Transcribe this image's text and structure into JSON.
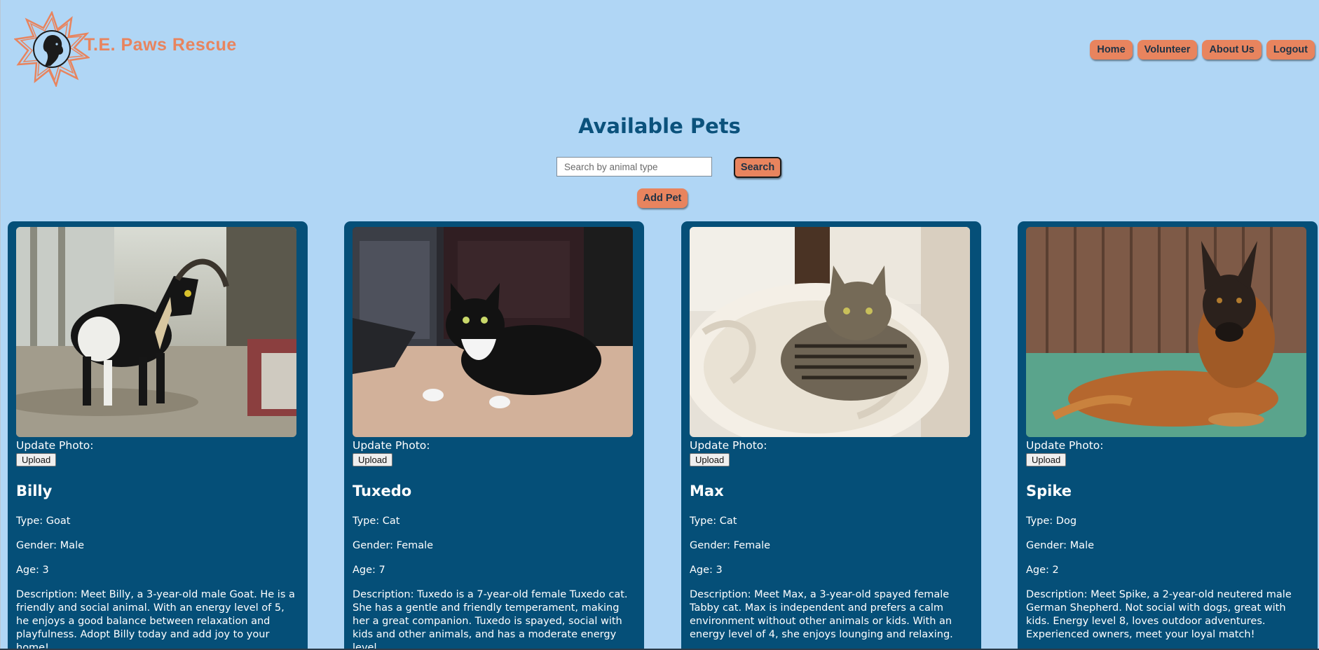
{
  "header": {
    "brand": "T.E. Paws Rescue",
    "nav": [
      "Home",
      "Volunteer",
      "About Us",
      "Logout"
    ]
  },
  "main": {
    "title": "Available Pets",
    "search": {
      "placeholder": "Search by animal type",
      "value": "",
      "button": "Search"
    },
    "add_pet": "Add Pet"
  },
  "pets": [
    {
      "update_label": "Update Photo:",
      "upload": "Upload",
      "name": "Billy",
      "type": "Type: Goat",
      "gender": "Gender: Male",
      "age": "Age: 3",
      "description": "Description: Meet Billy, a 3-year-old male Goat. He is a friendly and social animal. With an energy level of 5, he enjoys a good balance between relaxation and playfulness. Adopt Billy today and add joy to your home!"
    },
    {
      "update_label": "Update Photo:",
      "upload": "Upload",
      "name": "Tuxedo",
      "type": "Type: Cat",
      "gender": "Gender: Female",
      "age": "Age: 7",
      "description": "Description: Tuxedo is a 7-year-old female Tuxedo cat. She has a gentle and friendly temperament, making her a great companion. Tuxedo is spayed, social with kids and other animals, and has a moderate energy level."
    },
    {
      "update_label": "Update Photo:",
      "upload": "Upload",
      "name": "Max",
      "type": "Type: Cat",
      "gender": "Gender: Female",
      "age": "Age: 3",
      "description": "Description: Meet Max, a 3-year-old spayed female Tabby cat. Max is independent and prefers a calm environment without other animals or kids. With an energy level of 4, she enjoys lounging and relaxing."
    },
    {
      "update_label": "Update Photo:",
      "upload": "Upload",
      "name": "Spike",
      "type": "Type: Dog",
      "gender": "Gender: Male",
      "age": "Age: 2",
      "description": "Description: Meet Spike, a 2-year-old neutered male German Shepherd. Not social with dogs, great with kids. Energy level 8, loves outdoor adventures. Experienced owners, meet your loyal match!"
    }
  ],
  "colors": {
    "background": "#b0d6f5",
    "accent": "#e8845e",
    "card": "#054f78",
    "title": "#0b527c"
  },
  "icons": [
    "dog-star-logo-icon",
    "goat-photo",
    "tuxedo-cat-photo",
    "tabby-cat-photo",
    "german-shepherd-photo"
  ]
}
